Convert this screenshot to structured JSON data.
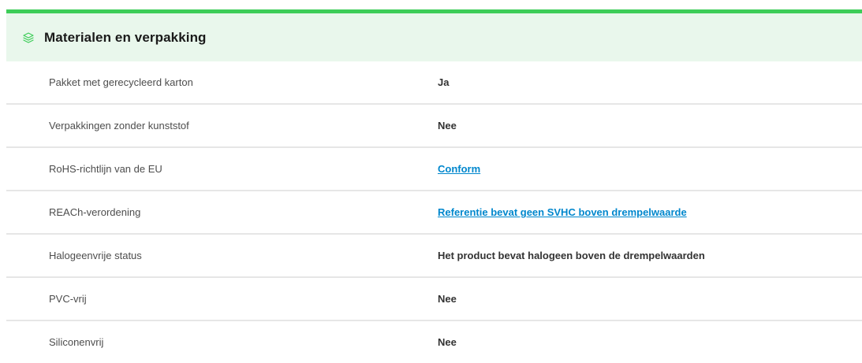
{
  "section": {
    "title": "Materialen en verpakking",
    "icon": "layers-icon",
    "accent_color": "#3dcd58",
    "header_bg": "#e9f7ec",
    "link_color": "#0087cd"
  },
  "rows": [
    {
      "label": "Pakket met gerecycleerd karton",
      "value": "Ja",
      "is_link": false
    },
    {
      "label": "Verpakkingen zonder kunststof",
      "value": "Nee",
      "is_link": false
    },
    {
      "label": "RoHS-richtlijn van de EU",
      "value": "Conform",
      "is_link": true
    },
    {
      "label": "REACh-verordening",
      "value": "Referentie bevat geen SVHC boven drempelwaarde",
      "is_link": true
    },
    {
      "label": "Halogeenvrije status",
      "value": "Het product bevat halogeen boven de drempelwaarden",
      "is_link": false
    },
    {
      "label": "PVC-vrij",
      "value": "Nee",
      "is_link": false
    },
    {
      "label": "Siliconenvrij",
      "value": "Nee",
      "is_link": false
    }
  ]
}
